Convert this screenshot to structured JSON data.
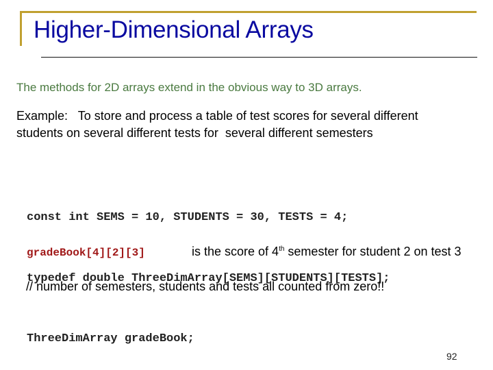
{
  "slide": {
    "title": "Higher-Dimensional Arrays",
    "intro": "The methods for 2D arrays extend in the obvious way to 3D arrays.",
    "example_lines": [
      "Example:   To store and process a table of test scores for several different",
      "students on several different tests for  several different semesters"
    ],
    "code_lines": [
      "const int SEMS = 10, STUDENTS = 30, TESTS = 4;",
      "typedef double ThreeDimArray[SEMS][STUDENTS][TESTS];",
      "ThreeDimArray gradeBook;"
    ],
    "access": {
      "code": "gradeBook[4][2][3]",
      "desc_before": "is the score of 4",
      "desc_sup": "th",
      "desc_after": " semester for student 2 on test 3"
    },
    "comment": "// number of semesters, students and tests all counted from zero!!",
    "page_number": "92"
  },
  "colors": {
    "title": "#0a0aa0",
    "accent_border": "#c0a030",
    "intro_text": "#4a7a40",
    "code_highlight": "#a01818"
  }
}
